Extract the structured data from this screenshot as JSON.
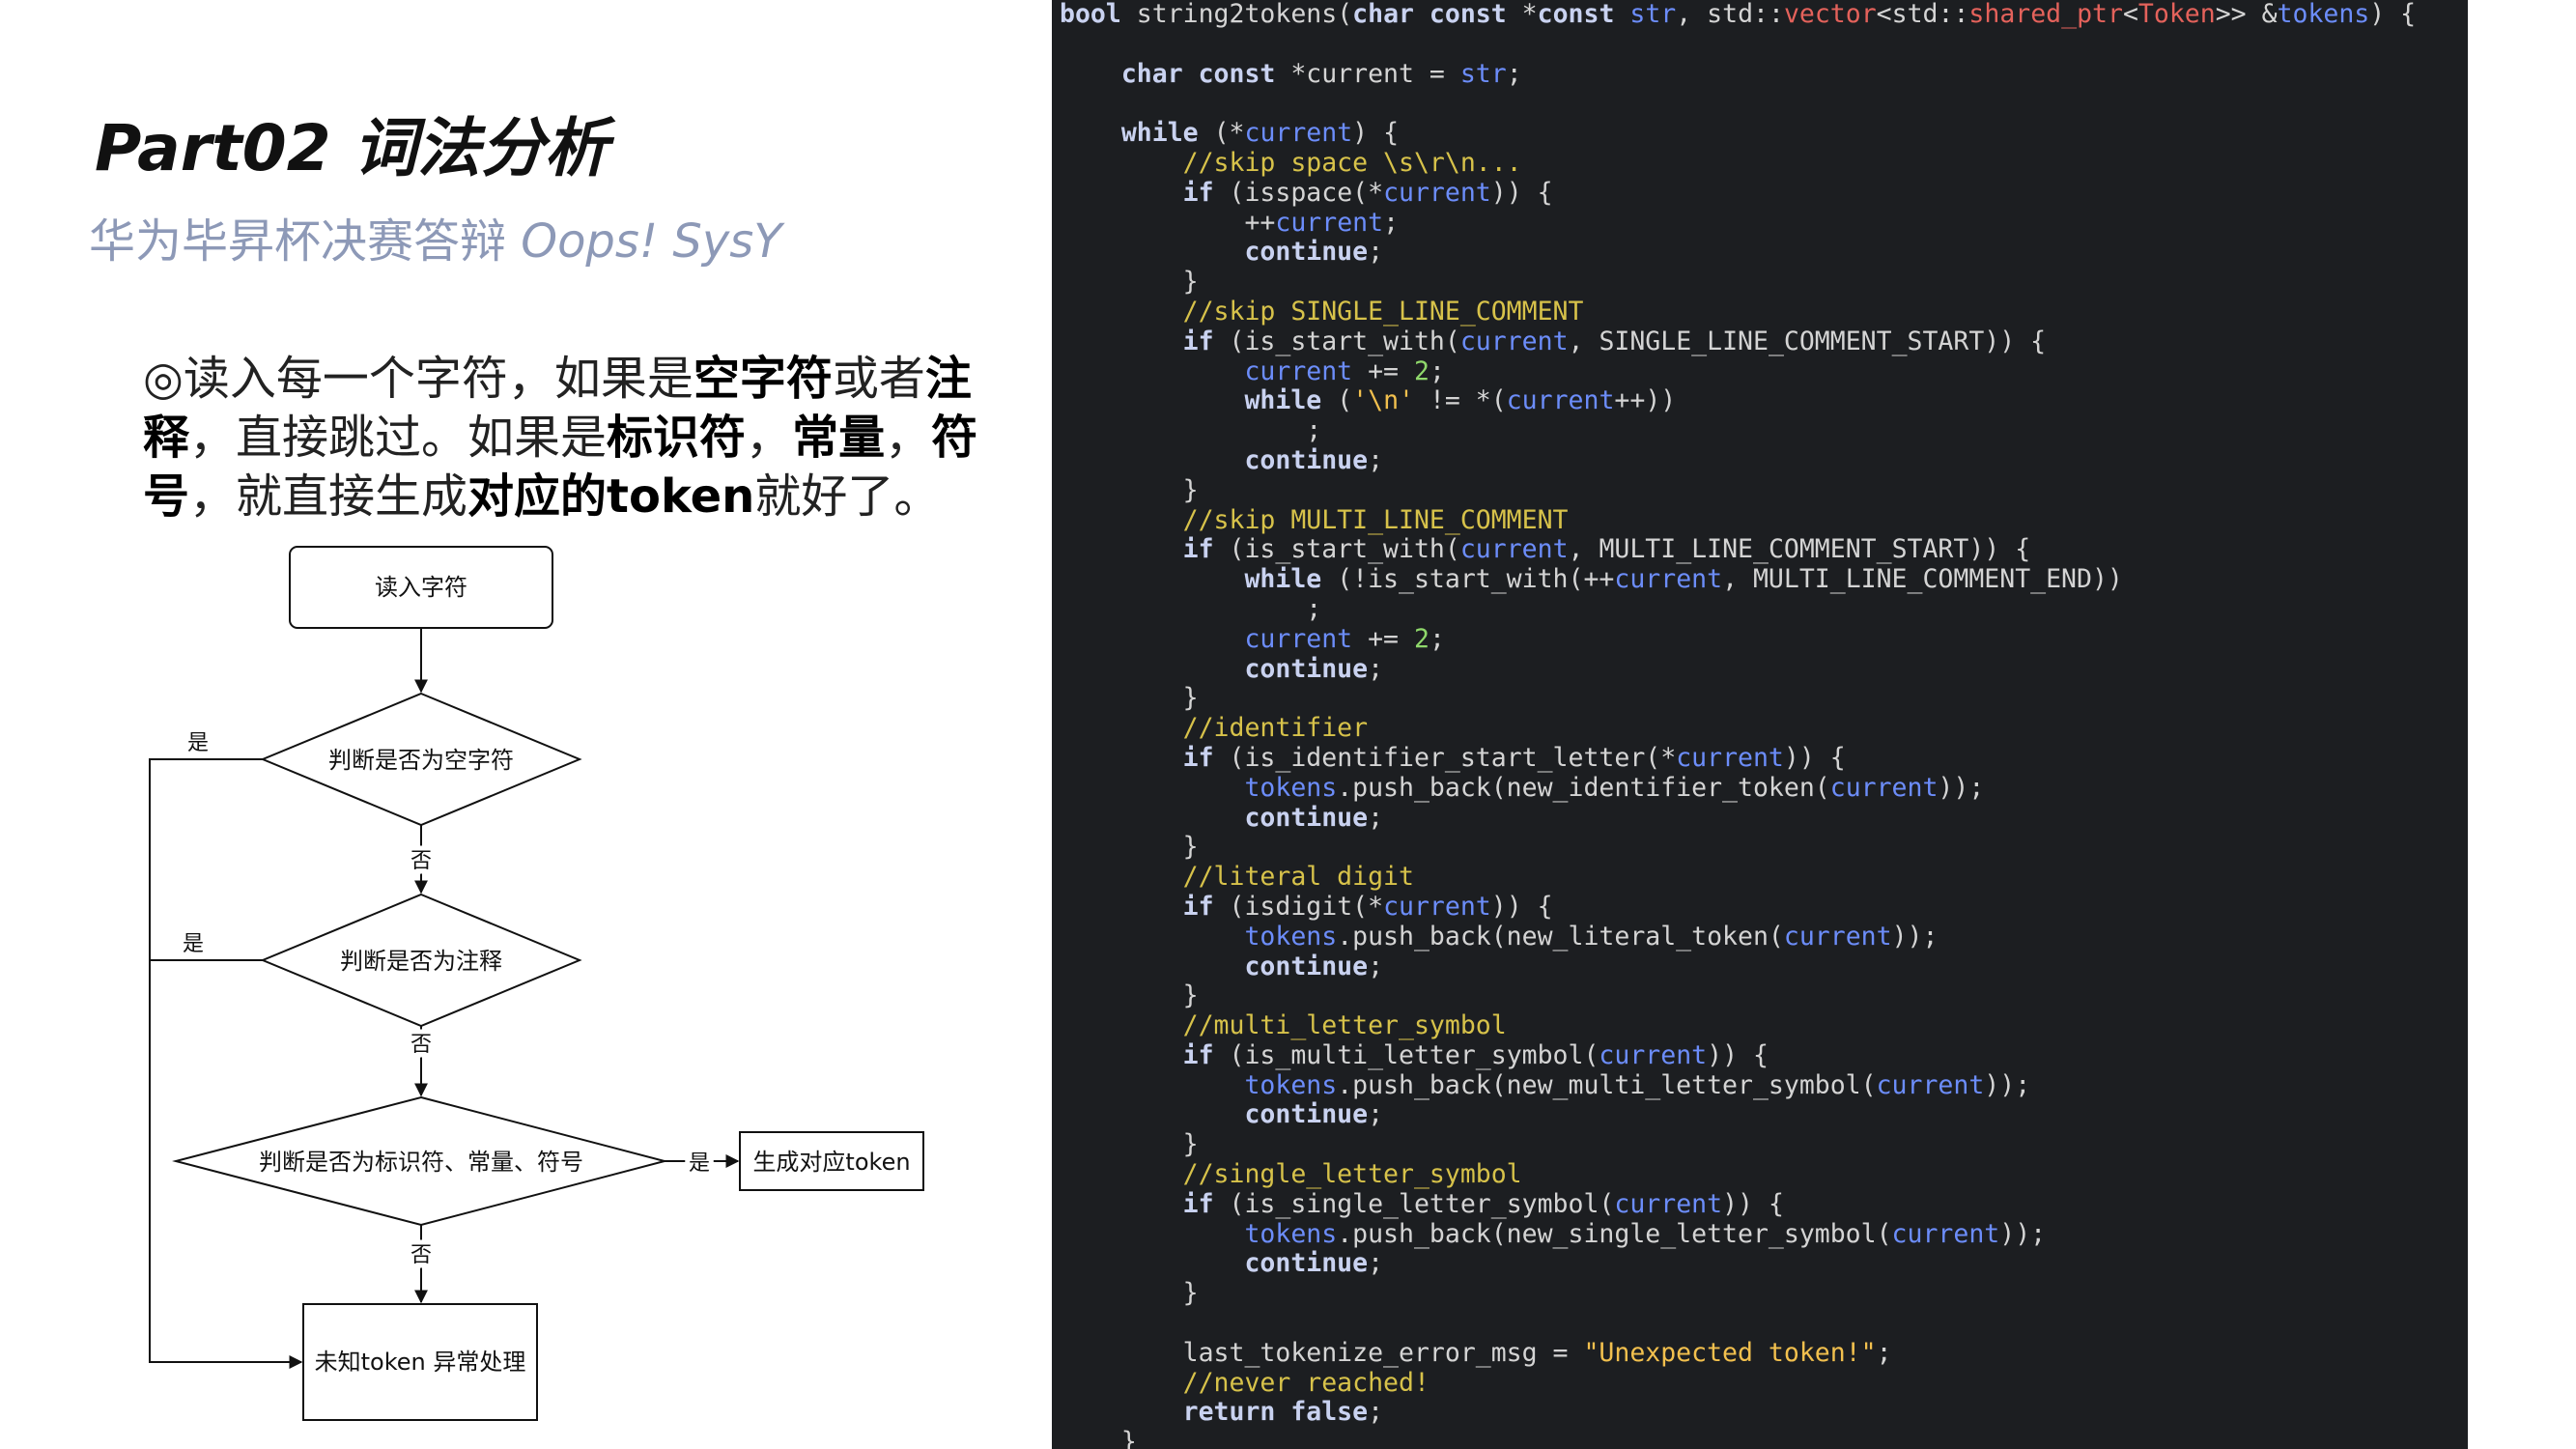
{
  "slide": {
    "title": "Part02 词法分析",
    "subtitle_cn": "华为毕昇杯决赛答辩",
    "subtitle_en": "Oops! SysY",
    "desc": [
      {
        "t": "◎读入每一个字符，如果是",
        "b": false
      },
      {
        "t": "空字符",
        "b": true
      },
      {
        "t": "或者",
        "b": false
      },
      {
        "t": "注释",
        "b": true
      },
      {
        "t": "，直接跳过。如果是",
        "b": false
      },
      {
        "t": "标识符",
        "b": true
      },
      {
        "t": "，",
        "b": false
      },
      {
        "t": "常量",
        "b": true
      },
      {
        "t": "，",
        "b": false
      },
      {
        "t": "符号",
        "b": true
      },
      {
        "t": "，就直接生成",
        "b": false
      },
      {
        "t": "对应的token",
        "b": true
      },
      {
        "t": "就好了。",
        "b": false
      }
    ]
  },
  "flowchart": {
    "start": "读入字符",
    "d1": "判断是否为空字符",
    "d2": "判断是否为注释",
    "d3": "判断是否为标识符、常量、符号",
    "gen": "生成对应token",
    "end": "未知token 异常处理",
    "yes": "是",
    "no": "否"
  },
  "colors": {
    "code_bg": "#1c1e21",
    "subtitle": "#8d99b7",
    "keyword": "#c9d2f0",
    "variable": "#6c8dfa",
    "comment": "#d7c24a",
    "number": "#8fd86b",
    "string": "#f2c04e",
    "type": "#e4625b"
  },
  "code": [
    [
      [
        "kw",
        "bool"
      ],
      [
        "p",
        " string2tokens("
      ],
      [
        "kw",
        "char const"
      ],
      [
        "p",
        " *"
      ],
      [
        "kw",
        "const"
      ],
      [
        "p",
        " "
      ],
      [
        "var",
        "str"
      ],
      [
        "p",
        ", std::"
      ],
      [
        "tp",
        "vector"
      ],
      [
        "p",
        "<std::"
      ],
      [
        "tp",
        "shared_ptr"
      ],
      [
        "p",
        "<"
      ],
      [
        "tp",
        "Token"
      ],
      [
        "p",
        ">> &"
      ],
      [
        "var",
        "tokens"
      ],
      [
        "p",
        ") {"
      ]
    ],
    [],
    [
      [
        "p",
        "    "
      ],
      [
        "kw",
        "char const"
      ],
      [
        "p",
        " *current = "
      ],
      [
        "var",
        "str"
      ],
      [
        "p",
        ";"
      ]
    ],
    [],
    [
      [
        "p",
        "    "
      ],
      [
        "kw",
        "while"
      ],
      [
        "p",
        " (*"
      ],
      [
        "var",
        "current"
      ],
      [
        "p",
        ") {"
      ]
    ],
    [
      [
        "p",
        "        "
      ],
      [
        "cm",
        "//skip space \\s\\r\\n..."
      ]
    ],
    [
      [
        "p",
        "        "
      ],
      [
        "kw",
        "if"
      ],
      [
        "p",
        " (isspace(*"
      ],
      [
        "var",
        "current"
      ],
      [
        "p",
        ")) {"
      ]
    ],
    [
      [
        "p",
        "            ++"
      ],
      [
        "var",
        "current"
      ],
      [
        "p",
        ";"
      ]
    ],
    [
      [
        "p",
        "            "
      ],
      [
        "kw",
        "continue"
      ],
      [
        "p",
        ";"
      ]
    ],
    [
      [
        "p",
        "        }"
      ]
    ],
    [
      [
        "p",
        "        "
      ],
      [
        "cm",
        "//skip SINGLE_LINE_COMMENT"
      ]
    ],
    [
      [
        "p",
        "        "
      ],
      [
        "kw",
        "if"
      ],
      [
        "p",
        " (is_start_with("
      ],
      [
        "var",
        "current"
      ],
      [
        "p",
        ", SINGLE_LINE_COMMENT_START)) {"
      ]
    ],
    [
      [
        "p",
        "            "
      ],
      [
        "var",
        "current"
      ],
      [
        "p",
        " += "
      ],
      [
        "num",
        "2"
      ],
      [
        "p",
        ";"
      ]
    ],
    [
      [
        "p",
        "            "
      ],
      [
        "kw",
        "while"
      ],
      [
        "p",
        " ("
      ],
      [
        "str",
        "'\\n'"
      ],
      [
        "p",
        " != *("
      ],
      [
        "var",
        "current"
      ],
      [
        "p",
        "++))"
      ]
    ],
    [
      [
        "p",
        "                ;"
      ]
    ],
    [
      [
        "p",
        "            "
      ],
      [
        "kw",
        "continue"
      ],
      [
        "p",
        ";"
      ]
    ],
    [
      [
        "p",
        "        }"
      ]
    ],
    [
      [
        "p",
        "        "
      ],
      [
        "cm",
        "//skip MULTI_LINE_COMMENT"
      ]
    ],
    [
      [
        "p",
        "        "
      ],
      [
        "kw",
        "if"
      ],
      [
        "p",
        " (is_start_with("
      ],
      [
        "var",
        "current"
      ],
      [
        "p",
        ", MULTI_LINE_COMMENT_START)) {"
      ]
    ],
    [
      [
        "p",
        "            "
      ],
      [
        "kw",
        "while"
      ],
      [
        "p",
        " (!is_start_with(++"
      ],
      [
        "var",
        "current"
      ],
      [
        "p",
        ", MULTI_LINE_COMMENT_END))"
      ]
    ],
    [
      [
        "p",
        "                ;"
      ]
    ],
    [
      [
        "p",
        "            "
      ],
      [
        "var",
        "current"
      ],
      [
        "p",
        " += "
      ],
      [
        "num",
        "2"
      ],
      [
        "p",
        ";"
      ]
    ],
    [
      [
        "p",
        "            "
      ],
      [
        "kw",
        "continue"
      ],
      [
        "p",
        ";"
      ]
    ],
    [
      [
        "p",
        "        }"
      ]
    ],
    [
      [
        "p",
        "        "
      ],
      [
        "cm",
        "//identifier"
      ]
    ],
    [
      [
        "p",
        "        "
      ],
      [
        "kw",
        "if"
      ],
      [
        "p",
        " (is_identifier_start_letter(*"
      ],
      [
        "var",
        "current"
      ],
      [
        "p",
        ")) {"
      ]
    ],
    [
      [
        "p",
        "            "
      ],
      [
        "var",
        "tokens"
      ],
      [
        "p",
        ".push_back(new_identifier_token("
      ],
      [
        "var",
        "current"
      ],
      [
        "p",
        "));"
      ]
    ],
    [
      [
        "p",
        "            "
      ],
      [
        "kw",
        "continue"
      ],
      [
        "p",
        ";"
      ]
    ],
    [
      [
        "p",
        "        }"
      ]
    ],
    [
      [
        "p",
        "        "
      ],
      [
        "cm",
        "//literal digit"
      ]
    ],
    [
      [
        "p",
        "        "
      ],
      [
        "kw",
        "if"
      ],
      [
        "p",
        " (isdigit(*"
      ],
      [
        "var",
        "current"
      ],
      [
        "p",
        ")) {"
      ]
    ],
    [
      [
        "p",
        "            "
      ],
      [
        "var",
        "tokens"
      ],
      [
        "p",
        ".push_back(new_literal_token("
      ],
      [
        "var",
        "current"
      ],
      [
        "p",
        "));"
      ]
    ],
    [
      [
        "p",
        "            "
      ],
      [
        "kw",
        "continue"
      ],
      [
        "p",
        ";"
      ]
    ],
    [
      [
        "p",
        "        }"
      ]
    ],
    [
      [
        "p",
        "        "
      ],
      [
        "cm",
        "//multi_letter_symbol"
      ]
    ],
    [
      [
        "p",
        "        "
      ],
      [
        "kw",
        "if"
      ],
      [
        "p",
        " (is_multi_letter_symbol("
      ],
      [
        "var",
        "current"
      ],
      [
        "p",
        ")) {"
      ]
    ],
    [
      [
        "p",
        "            "
      ],
      [
        "var",
        "tokens"
      ],
      [
        "p",
        ".push_back(new_multi_letter_symbol("
      ],
      [
        "var",
        "current"
      ],
      [
        "p",
        "));"
      ]
    ],
    [
      [
        "p",
        "            "
      ],
      [
        "kw",
        "continue"
      ],
      [
        "p",
        ";"
      ]
    ],
    [
      [
        "p",
        "        }"
      ]
    ],
    [
      [
        "p",
        "        "
      ],
      [
        "cm",
        "//single_letter_symbol"
      ]
    ],
    [
      [
        "p",
        "        "
      ],
      [
        "kw",
        "if"
      ],
      [
        "p",
        " (is_single_letter_symbol("
      ],
      [
        "var",
        "current"
      ],
      [
        "p",
        ")) {"
      ]
    ],
    [
      [
        "p",
        "            "
      ],
      [
        "var",
        "tokens"
      ],
      [
        "p",
        ".push_back(new_single_letter_symbol("
      ],
      [
        "var",
        "current"
      ],
      [
        "p",
        "));"
      ]
    ],
    [
      [
        "p",
        "            "
      ],
      [
        "kw",
        "continue"
      ],
      [
        "p",
        ";"
      ]
    ],
    [
      [
        "p",
        "        }"
      ]
    ],
    [],
    [
      [
        "p",
        "        last_tokenize_error_msg = "
      ],
      [
        "str",
        "\"Unexpected token!\""
      ],
      [
        "p",
        ";"
      ]
    ],
    [
      [
        "p",
        "        "
      ],
      [
        "cm",
        "//never reached!"
      ]
    ],
    [
      [
        "p",
        "        "
      ],
      [
        "kw",
        "return false"
      ],
      [
        "p",
        ";"
      ]
    ],
    [
      [
        "p",
        "    }"
      ]
    ]
  ]
}
